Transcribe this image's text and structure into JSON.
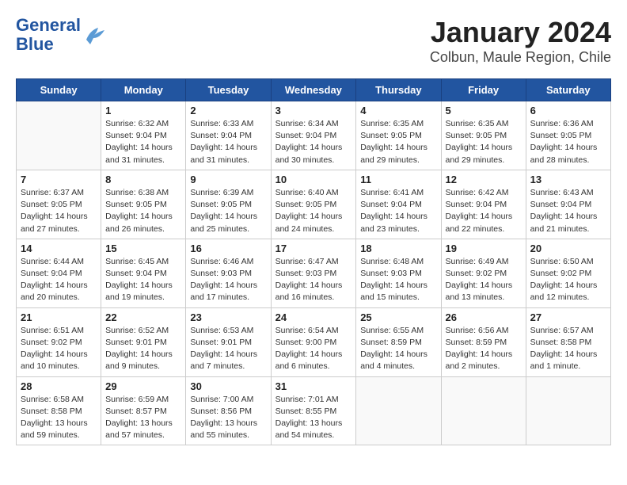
{
  "header": {
    "logo_line1": "General",
    "logo_line2": "Blue",
    "title": "January 2024",
    "subtitle": "Colbun, Maule Region, Chile"
  },
  "weekdays": [
    "Sunday",
    "Monday",
    "Tuesday",
    "Wednesday",
    "Thursday",
    "Friday",
    "Saturday"
  ],
  "weeks": [
    [
      {
        "num": "",
        "info": ""
      },
      {
        "num": "1",
        "info": "Sunrise: 6:32 AM\nSunset: 9:04 PM\nDaylight: 14 hours\nand 31 minutes."
      },
      {
        "num": "2",
        "info": "Sunrise: 6:33 AM\nSunset: 9:04 PM\nDaylight: 14 hours\nand 31 minutes."
      },
      {
        "num": "3",
        "info": "Sunrise: 6:34 AM\nSunset: 9:04 PM\nDaylight: 14 hours\nand 30 minutes."
      },
      {
        "num": "4",
        "info": "Sunrise: 6:35 AM\nSunset: 9:05 PM\nDaylight: 14 hours\nand 29 minutes."
      },
      {
        "num": "5",
        "info": "Sunrise: 6:35 AM\nSunset: 9:05 PM\nDaylight: 14 hours\nand 29 minutes."
      },
      {
        "num": "6",
        "info": "Sunrise: 6:36 AM\nSunset: 9:05 PM\nDaylight: 14 hours\nand 28 minutes."
      }
    ],
    [
      {
        "num": "7",
        "info": "Sunrise: 6:37 AM\nSunset: 9:05 PM\nDaylight: 14 hours\nand 27 minutes."
      },
      {
        "num": "8",
        "info": "Sunrise: 6:38 AM\nSunset: 9:05 PM\nDaylight: 14 hours\nand 26 minutes."
      },
      {
        "num": "9",
        "info": "Sunrise: 6:39 AM\nSunset: 9:05 PM\nDaylight: 14 hours\nand 25 minutes."
      },
      {
        "num": "10",
        "info": "Sunrise: 6:40 AM\nSunset: 9:05 PM\nDaylight: 14 hours\nand 24 minutes."
      },
      {
        "num": "11",
        "info": "Sunrise: 6:41 AM\nSunset: 9:04 PM\nDaylight: 14 hours\nand 23 minutes."
      },
      {
        "num": "12",
        "info": "Sunrise: 6:42 AM\nSunset: 9:04 PM\nDaylight: 14 hours\nand 22 minutes."
      },
      {
        "num": "13",
        "info": "Sunrise: 6:43 AM\nSunset: 9:04 PM\nDaylight: 14 hours\nand 21 minutes."
      }
    ],
    [
      {
        "num": "14",
        "info": "Sunrise: 6:44 AM\nSunset: 9:04 PM\nDaylight: 14 hours\nand 20 minutes."
      },
      {
        "num": "15",
        "info": "Sunrise: 6:45 AM\nSunset: 9:04 PM\nDaylight: 14 hours\nand 19 minutes."
      },
      {
        "num": "16",
        "info": "Sunrise: 6:46 AM\nSunset: 9:03 PM\nDaylight: 14 hours\nand 17 minutes."
      },
      {
        "num": "17",
        "info": "Sunrise: 6:47 AM\nSunset: 9:03 PM\nDaylight: 14 hours\nand 16 minutes."
      },
      {
        "num": "18",
        "info": "Sunrise: 6:48 AM\nSunset: 9:03 PM\nDaylight: 14 hours\nand 15 minutes."
      },
      {
        "num": "19",
        "info": "Sunrise: 6:49 AM\nSunset: 9:02 PM\nDaylight: 14 hours\nand 13 minutes."
      },
      {
        "num": "20",
        "info": "Sunrise: 6:50 AM\nSunset: 9:02 PM\nDaylight: 14 hours\nand 12 minutes."
      }
    ],
    [
      {
        "num": "21",
        "info": "Sunrise: 6:51 AM\nSunset: 9:02 PM\nDaylight: 14 hours\nand 10 minutes."
      },
      {
        "num": "22",
        "info": "Sunrise: 6:52 AM\nSunset: 9:01 PM\nDaylight: 14 hours\nand 9 minutes."
      },
      {
        "num": "23",
        "info": "Sunrise: 6:53 AM\nSunset: 9:01 PM\nDaylight: 14 hours\nand 7 minutes."
      },
      {
        "num": "24",
        "info": "Sunrise: 6:54 AM\nSunset: 9:00 PM\nDaylight: 14 hours\nand 6 minutes."
      },
      {
        "num": "25",
        "info": "Sunrise: 6:55 AM\nSunset: 8:59 PM\nDaylight: 14 hours\nand 4 minutes."
      },
      {
        "num": "26",
        "info": "Sunrise: 6:56 AM\nSunset: 8:59 PM\nDaylight: 14 hours\nand 2 minutes."
      },
      {
        "num": "27",
        "info": "Sunrise: 6:57 AM\nSunset: 8:58 PM\nDaylight: 14 hours\nand 1 minute."
      }
    ],
    [
      {
        "num": "28",
        "info": "Sunrise: 6:58 AM\nSunset: 8:58 PM\nDaylight: 13 hours\nand 59 minutes."
      },
      {
        "num": "29",
        "info": "Sunrise: 6:59 AM\nSunset: 8:57 PM\nDaylight: 13 hours\nand 57 minutes."
      },
      {
        "num": "30",
        "info": "Sunrise: 7:00 AM\nSunset: 8:56 PM\nDaylight: 13 hours\nand 55 minutes."
      },
      {
        "num": "31",
        "info": "Sunrise: 7:01 AM\nSunset: 8:55 PM\nDaylight: 13 hours\nand 54 minutes."
      },
      {
        "num": "",
        "info": ""
      },
      {
        "num": "",
        "info": ""
      },
      {
        "num": "",
        "info": ""
      }
    ]
  ]
}
